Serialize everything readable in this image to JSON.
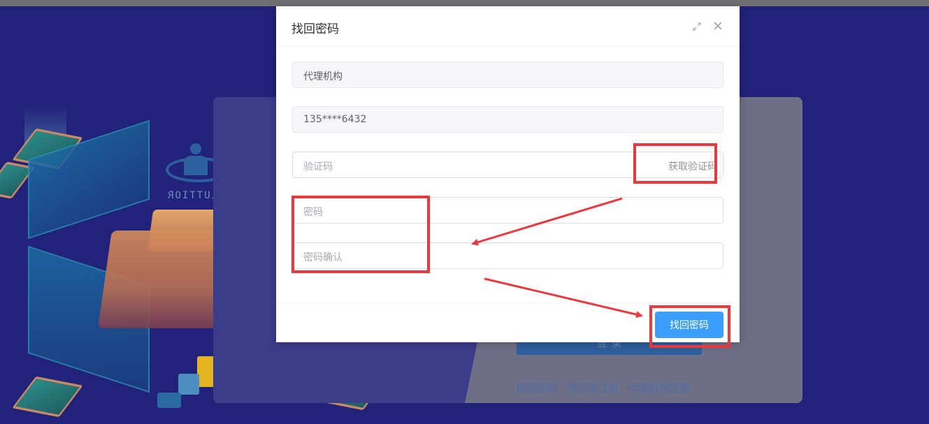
{
  "dialog": {
    "title": "找回密码",
    "fields": {
      "agency": "代理机构",
      "phone": "135****6432",
      "code_placeholder": "验证码",
      "get_code_button": "获取验证码",
      "password_placeholder": "密码",
      "confirm_placeholder": "密码确认"
    },
    "submit_label": "找回密码"
  },
  "background": {
    "login_button_label": "登 录",
    "links": [
      "找回密码",
      "供应商注册",
      "代理机构注册"
    ],
    "sign_text": "LUTTIOR"
  },
  "colors": {
    "page_background": "#212279",
    "primary_button": "#3a9efa",
    "annotation_red": "#e8393f"
  },
  "icons": [
    "fullscreen-icon",
    "close-icon"
  ]
}
